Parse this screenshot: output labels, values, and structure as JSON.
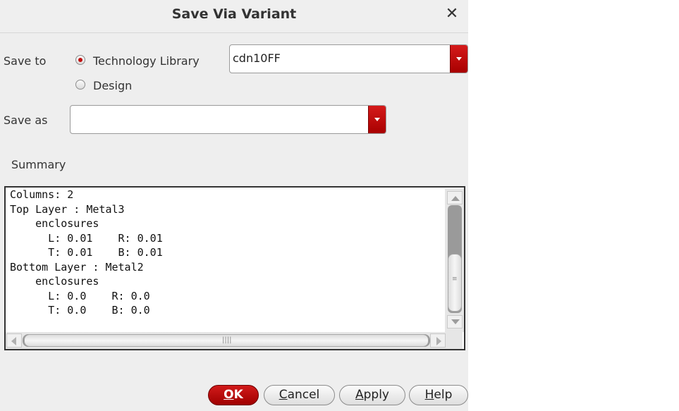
{
  "dialog": {
    "title": "Save Via Variant",
    "close_glyph": "✕"
  },
  "save_to": {
    "label": "Save to",
    "options": [
      {
        "label": "Technology Library",
        "selected": true
      },
      {
        "label": "Design",
        "selected": false
      }
    ],
    "library": "cdn10FF"
  },
  "save_as": {
    "label": "Save as",
    "value": ""
  },
  "summary": {
    "label": "Summary",
    "text": "Columns: 2\nTop Layer : Metal3\n    enclosures\n      L: 0.01    R: 0.01\n      T: 0.01    B: 0.01\nBottom Layer : Metal2\n    enclosures\n      L: 0.0    R: 0.0\n      T: 0.0    B: 0.0"
  },
  "buttons": {
    "ok": {
      "mnemonic": "O",
      "rest": "K"
    },
    "cancel": {
      "mnemonic": "C",
      "rest": "ancel"
    },
    "apply": {
      "mnemonic": "A",
      "rest": "pply"
    },
    "help": {
      "mnemonic": "H",
      "rest": "elp"
    }
  },
  "colors": {
    "accent": "#c01010",
    "dialog_bg": "#eeeeee"
  },
  "icons": {
    "close": "close-icon",
    "dropdown": "chevron-down-icon"
  }
}
